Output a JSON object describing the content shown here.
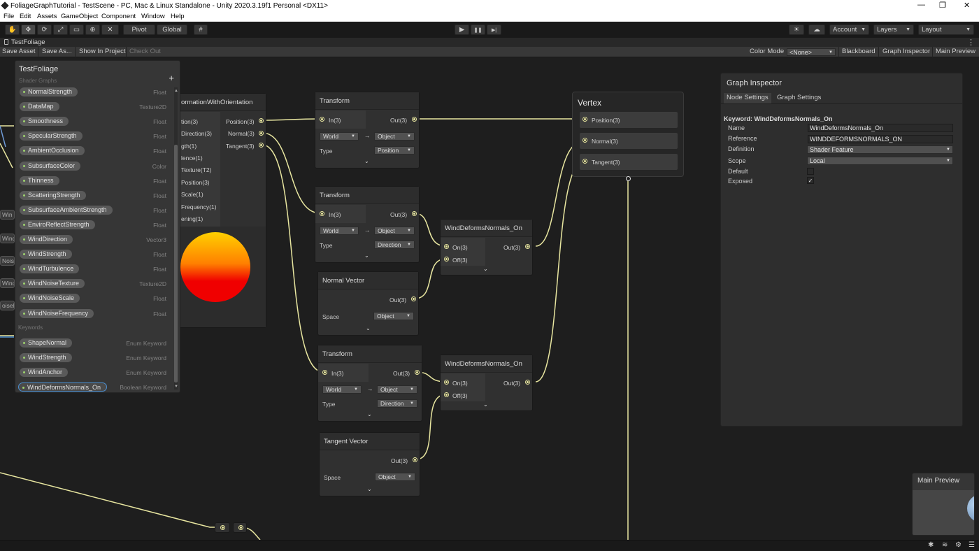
{
  "window": {
    "title": "FoliageGraphTutorial - TestScene - PC, Mac & Linux Standalone - Unity 2020.3.19f1 Personal <DX11>",
    "minimize": "—",
    "maximize": "❐",
    "close": "✕"
  },
  "menu": [
    "File",
    "Edit",
    "Assets",
    "GameObject",
    "Component",
    "Window",
    "Help"
  ],
  "toolbar": {
    "pivot": "Pivot",
    "global": "Global",
    "account": "Account",
    "layers": "Layers",
    "layout": "Layout",
    "icons": [
      "hand-icon",
      "move-icon",
      "rotate-icon",
      "scale-icon",
      "rect-icon",
      "transform-icon",
      "custom-tool-icon",
      "grid-icon",
      "play-icon",
      "pause-icon",
      "step-icon",
      "collab-icon",
      "cloud-icon"
    ],
    "play": "▶",
    "pause": "❚❚",
    "step": "▶|"
  },
  "tab": {
    "label": "TestFoliage"
  },
  "graph_toolbar": {
    "save_asset": "Save Asset",
    "save_as": "Save As...",
    "show_in_project": "Show In Project",
    "check_out": "Check Out",
    "color_mode_label": "Color Mode",
    "color_mode_value": "<None>",
    "blackboard": "Blackboard",
    "graph_inspector": "Graph Inspector",
    "main_preview": "Main Preview"
  },
  "blackboard": {
    "title": "TestFoliage",
    "subtitle": "Shader Graphs",
    "add": "+",
    "properties": [
      {
        "name": "NormalStrength",
        "type": "Float"
      },
      {
        "name": "DataMap",
        "type": "Texture2D"
      },
      {
        "name": "Smoothness",
        "type": "Float"
      },
      {
        "name": "SpecularStrength",
        "type": "Float"
      },
      {
        "name": "AmbientOcclusion",
        "type": "Float"
      },
      {
        "name": "SubsurfaceColor",
        "type": "Color"
      },
      {
        "name": "Thinness",
        "type": "Float"
      },
      {
        "name": "ScatteringStrength",
        "type": "Float"
      },
      {
        "name": "SubsurfaceAmbientStrength",
        "type": "Float"
      },
      {
        "name": "EnviroReflectStrength",
        "type": "Float"
      },
      {
        "name": "WindDirection",
        "type": "Vector3"
      },
      {
        "name": "WindStrength",
        "type": "Float"
      },
      {
        "name": "WindTurbulence",
        "type": "Float"
      },
      {
        "name": "WindNoiseTexture",
        "type": "Texture2D"
      },
      {
        "name": "WindNoiseScale",
        "type": "Float"
      },
      {
        "name": "WindNoiseFrequency",
        "type": "Float"
      }
    ],
    "keywords_label": "Keywords",
    "keywords": [
      {
        "name": "ShapeNormal",
        "type": "Enum Keyword"
      },
      {
        "name": "WindStrength",
        "type": "Enum Keyword"
      },
      {
        "name": "WindAnchor",
        "type": "Enum Keyword"
      },
      {
        "name": "WindDeformsNormals_On",
        "type": "Boolean Keyword"
      }
    ]
  },
  "edge_fragments": [
    "Win",
    "WindT",
    "Noise",
    "WindN",
    "oiseF"
  ],
  "sub_node": {
    "title": "ormationWithOrientation",
    "inputs": [
      "tion(3)",
      "Direction(3)",
      "gth(1)",
      "lence(1)",
      "Texture(T2)",
      "Position(3)",
      "Scale(1)",
      "Frequency(1)",
      "ening(1)"
    ],
    "outputs": [
      "Position(3)",
      "Normal(3)",
      "Tangent(3)"
    ]
  },
  "transform_nodes": [
    {
      "title": "Transform",
      "in": "In(3)",
      "out": "Out(3)",
      "from": "World",
      "arrow": "→",
      "to": "Object",
      "type_label": "Type",
      "type_value": "Position",
      "chevron": "⌄"
    },
    {
      "title": "Transform",
      "in": "In(3)",
      "out": "Out(3)",
      "from": "World",
      "arrow": "→",
      "to": "Object",
      "type_label": "Type",
      "type_value": "Direction",
      "chevron": "⌄"
    },
    {
      "title": "Transform",
      "in": "In(3)",
      "out": "Out(3)",
      "from": "World",
      "arrow": "→",
      "to": "Object",
      "type_label": "Type",
      "type_value": "Direction",
      "chevron": "⌄"
    }
  ],
  "vector_nodes": [
    {
      "title": "Normal Vector",
      "out": "Out(3)",
      "space_label": "Space",
      "space_value": "Object",
      "chevron": "⌄"
    },
    {
      "title": "Tangent Vector",
      "out": "Out(3)",
      "space_label": "Space",
      "space_value": "Object",
      "chevron": "⌄"
    }
  ],
  "keyword_nodes": [
    {
      "title": "WindDeformsNormals_On",
      "on": "On(3)",
      "off": "Off(3)",
      "out": "Out(3)",
      "chevron": "⌄"
    },
    {
      "title": "WindDeformsNormals_On",
      "on": "On(3)",
      "off": "Off(3)",
      "out": "Out(3)",
      "chevron": "⌄"
    }
  ],
  "vertex": {
    "title": "Vertex",
    "ports": [
      "Position(3)",
      "Normal(3)",
      "Tangent(3)"
    ]
  },
  "inspector": {
    "title": "Graph Inspector",
    "tabs": [
      "Node Settings",
      "Graph Settings"
    ],
    "heading": "Keyword: WindDeformsNormals_On",
    "name_label": "Name",
    "name_value": "WindDeformsNormals_On",
    "reference_label": "Reference",
    "reference_value": "WINDDEFORMSNORMALS_ON",
    "definition_label": "Definition",
    "definition_value": "Shader Feature",
    "scope_label": "Scope",
    "scope_value": "Local",
    "default_label": "Default",
    "default_checked": false,
    "exposed_label": "Exposed",
    "exposed_checked": true,
    "check_glyph": "✓"
  },
  "main_preview": {
    "title": "Main Preview"
  },
  "colors": {
    "wire": "#e8e6a0",
    "accent": "#4c8fd0",
    "keyword": "#9ed36e"
  }
}
